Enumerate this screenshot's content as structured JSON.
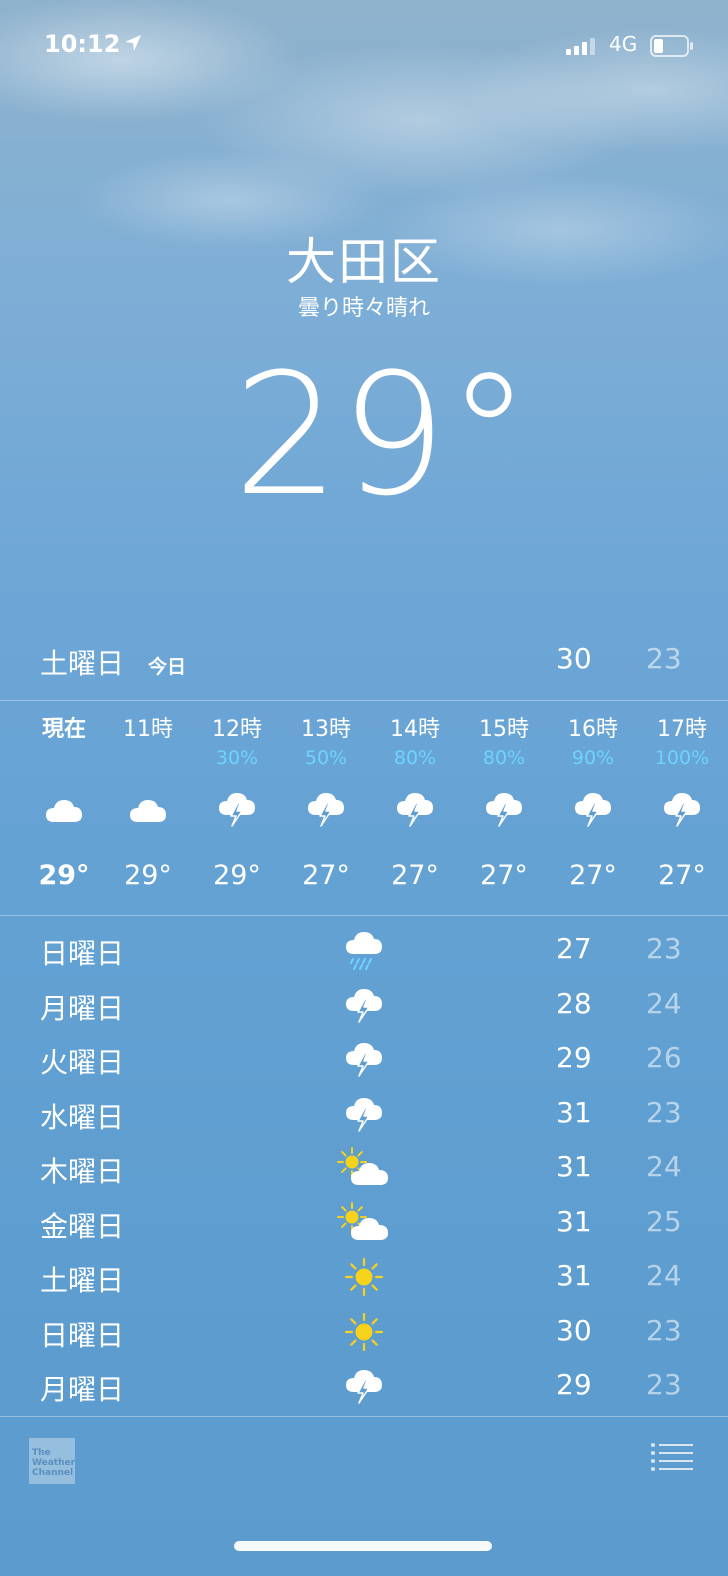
{
  "status_bar": {
    "time": "10:12",
    "network": "4G",
    "icons": [
      "location-arrow-icon",
      "signal-bars-icon",
      "battery-icon"
    ]
  },
  "location": {
    "city": "大田区",
    "condition": "曇り時々晴れ",
    "temperature": "29°"
  },
  "today": {
    "day": "土曜日",
    "tag": "今日",
    "high": "30",
    "low": "23"
  },
  "hourly": [
    {
      "label": "現在",
      "pop": "",
      "icon": "cloud",
      "temp": "29°"
    },
    {
      "label": "11時",
      "pop": "",
      "icon": "cloud",
      "temp": "29°"
    },
    {
      "label": "12時",
      "pop": "30%",
      "icon": "thunderstorm",
      "temp": "29°"
    },
    {
      "label": "13時",
      "pop": "50%",
      "icon": "thunderstorm",
      "temp": "27°"
    },
    {
      "label": "14時",
      "pop": "80%",
      "icon": "thunderstorm",
      "temp": "27°"
    },
    {
      "label": "15時",
      "pop": "80%",
      "icon": "thunderstorm",
      "temp": "27°"
    },
    {
      "label": "16時",
      "pop": "90%",
      "icon": "thunderstorm",
      "temp": "27°"
    },
    {
      "label": "17時",
      "pop": "100%",
      "icon": "thunderstorm",
      "temp": "27°"
    }
  ],
  "daily": [
    {
      "day": "日曜日",
      "icon": "rain",
      "high": "27",
      "low": "23"
    },
    {
      "day": "月曜日",
      "icon": "thunderstorm",
      "high": "28",
      "low": "24"
    },
    {
      "day": "火曜日",
      "icon": "thunderstorm",
      "high": "29",
      "low": "26"
    },
    {
      "day": "水曜日",
      "icon": "thunderstorm",
      "high": "31",
      "low": "23"
    },
    {
      "day": "木曜日",
      "icon": "partly-sunny",
      "high": "31",
      "low": "24"
    },
    {
      "day": "金曜日",
      "icon": "partly-sunny",
      "high": "31",
      "low": "25"
    },
    {
      "day": "土曜日",
      "icon": "sunny",
      "high": "31",
      "low": "24"
    },
    {
      "day": "日曜日",
      "icon": "sunny",
      "high": "30",
      "low": "23"
    },
    {
      "day": "月曜日",
      "icon": "thunderstorm",
      "high": "29",
      "low": "23"
    }
  ],
  "footer": {
    "logo_text": "The Weather Channel"
  },
  "colors": {
    "precip": "#6fd3ff",
    "sun": "#f7d21a",
    "low_temp": "rgba(255,255,255,0.55)"
  }
}
